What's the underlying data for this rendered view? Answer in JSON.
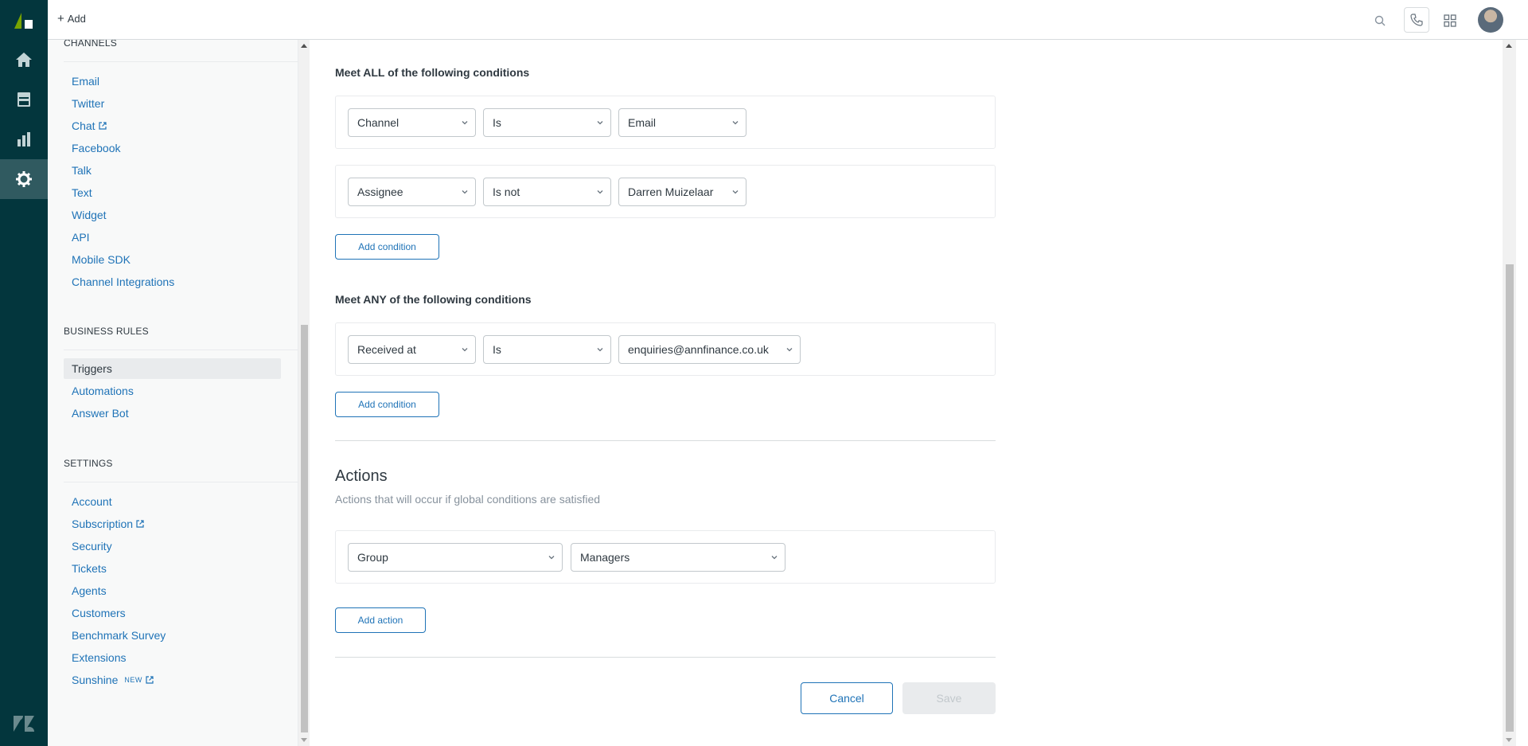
{
  "topbar": {
    "add_label": "Add",
    "icons": [
      "search-icon",
      "phone-icon",
      "apps-grid-icon",
      "avatar"
    ]
  },
  "rail": {
    "icons": [
      "product-logo-icon",
      "home-icon",
      "views-icon",
      "reporting-icon",
      "admin-gear-icon",
      "zendesk-logo-icon"
    ]
  },
  "sidebar": {
    "channels": {
      "title": "CHANNELS",
      "items": [
        {
          "label": "Email"
        },
        {
          "label": "Twitter"
        },
        {
          "label": "Chat"
        },
        {
          "label": "Facebook"
        },
        {
          "label": "Talk"
        },
        {
          "label": "Text"
        },
        {
          "label": "Widget"
        },
        {
          "label": "API"
        },
        {
          "label": "Mobile SDK"
        },
        {
          "label": "Channel Integrations"
        }
      ]
    },
    "business_rules": {
      "title": "BUSINESS RULES",
      "items": [
        {
          "label": "Triggers"
        },
        {
          "label": "Automations"
        },
        {
          "label": "Answer Bot"
        }
      ]
    },
    "settings": {
      "title": "SETTINGS",
      "items": [
        {
          "label": "Account"
        },
        {
          "label": "Subscription"
        },
        {
          "label": "Security"
        },
        {
          "label": "Tickets"
        },
        {
          "label": "Agents"
        },
        {
          "label": "Customers"
        },
        {
          "label": "Benchmark Survey"
        },
        {
          "label": "Extensions"
        },
        {
          "label": "Sunshine",
          "badge": "NEW"
        }
      ]
    }
  },
  "conditions_all": {
    "title": "Meet ALL of the following conditions",
    "rows": [
      {
        "field": "Channel",
        "operator": "Is",
        "value": "Email"
      },
      {
        "field": "Assignee",
        "operator": "Is not",
        "value": "Darren Muizelaar"
      }
    ],
    "add_label": "Add condition"
  },
  "conditions_any": {
    "title": "Meet ANY of the following conditions",
    "rows": [
      {
        "field": "Received at",
        "operator": "Is",
        "value": "enquiries@annfinance.co.uk"
      }
    ],
    "add_label": "Add condition"
  },
  "actions": {
    "title": "Actions",
    "subtitle": "Actions that will occur if global conditions are satisfied",
    "rows": [
      {
        "field": "Group",
        "value": "Managers"
      }
    ],
    "add_label": "Add action"
  },
  "footer": {
    "cancel_label": "Cancel",
    "save_label": "Save"
  },
  "colors": {
    "rail": "#03363d",
    "link": "#1f73b7",
    "text": "#2f3941",
    "muted": "#87929d"
  }
}
